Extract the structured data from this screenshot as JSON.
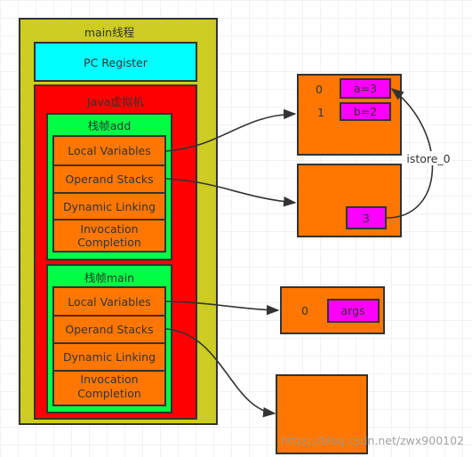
{
  "colors": {
    "thread": "#cccc22",
    "pc": "#00ffff",
    "jvm": "#ff0000",
    "frame": "#00ff44",
    "slot": "#ff7700",
    "value": "#ff00ff"
  },
  "thread": {
    "title": "main线程"
  },
  "pc_register": {
    "label": "PC Register"
  },
  "jvm": {
    "title": "Java虚拟机"
  },
  "frames": [
    {
      "title": "栈帧add",
      "rows": [
        "Local Variables",
        "Operand Stacks",
        "Dynamic Linking",
        "Invocation",
        "Completion"
      ]
    },
    {
      "title": "栈帧main",
      "rows": [
        "Local Variables",
        "Operand Stacks",
        "Dynamic Linking",
        "Invocation",
        "Completion"
      ]
    }
  ],
  "add_locals": {
    "index0": "0",
    "index1": "1",
    "value0": "a=3",
    "value1": "b=2"
  },
  "add_stack": {
    "value": "3"
  },
  "edge_label": "istore_0",
  "main_locals": {
    "index0": "0",
    "value0": "args"
  },
  "watermark": "https://blog.csdn.net/zwx900102"
}
